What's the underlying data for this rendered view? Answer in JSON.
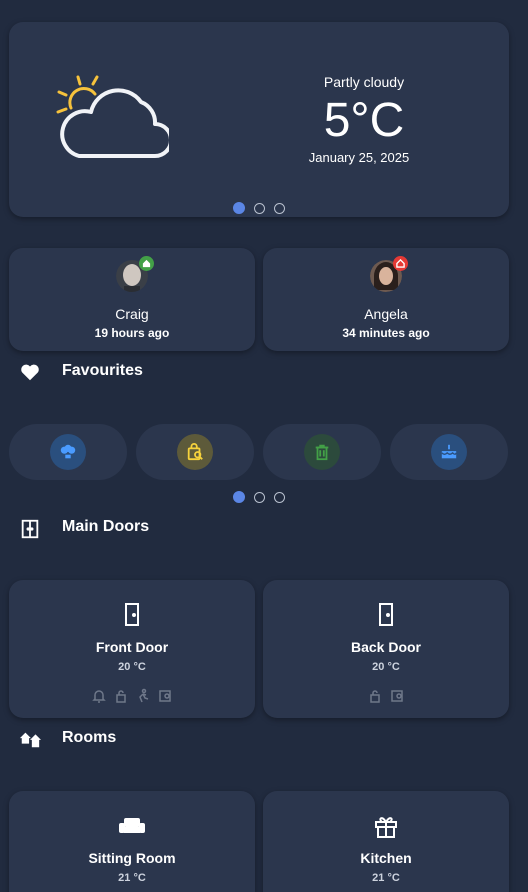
{
  "weather": {
    "condition": "Partly cloudy",
    "temperature": "5°C",
    "date": "January 25, 2025",
    "icon": "partly-cloudy-icon",
    "page_index": 1,
    "page_count": 3
  },
  "people": [
    {
      "name": "Craig",
      "last_seen": "19 hours ago",
      "status_icon": "home-icon",
      "status_color": "#43a047"
    },
    {
      "name": "Angela",
      "last_seen": "34 minutes ago",
      "status_icon": "away-icon",
      "status_color": "#e53935"
    }
  ],
  "favourites": {
    "title": "Favourites",
    "icon": "heart-icon",
    "items": [
      {
        "icon": "lightbulb-group-icon",
        "color": "#4a9bff",
        "bg": "#2a4f7e"
      },
      {
        "icon": "shopping-bag-search-icon",
        "color": "#f6d23c",
        "bg": "#5d5a3a"
      },
      {
        "icon": "trash-can-icon",
        "color": "#43a047",
        "bg": "#2c4a3c"
      },
      {
        "icon": "birthday-cake-icon",
        "color": "#4a9bff",
        "bg": "#2a4f7e"
      }
    ],
    "page_index": 1,
    "page_count": 3
  },
  "main_doors": {
    "title": "Main Doors",
    "icon": "door-icon",
    "items": [
      {
        "name": "Front Door",
        "temp": "20 °C",
        "icon": "door-icon",
        "status_icons": [
          "bell-icon",
          "lock-icon",
          "motion-icon",
          "camera-icon"
        ]
      },
      {
        "name": "Back Door",
        "temp": "20 °C",
        "icon": "door-icon",
        "status_icons": [
          "lock-icon",
          "camera-icon"
        ]
      }
    ]
  },
  "rooms": {
    "title": "Rooms",
    "icon": "home-group-icon",
    "items": [
      {
        "name": "Sitting Room",
        "temp": "21 °C",
        "icon": "sofa-icon"
      },
      {
        "name": "Kitchen",
        "temp": "21 °C",
        "icon": "gift-icon"
      }
    ]
  }
}
